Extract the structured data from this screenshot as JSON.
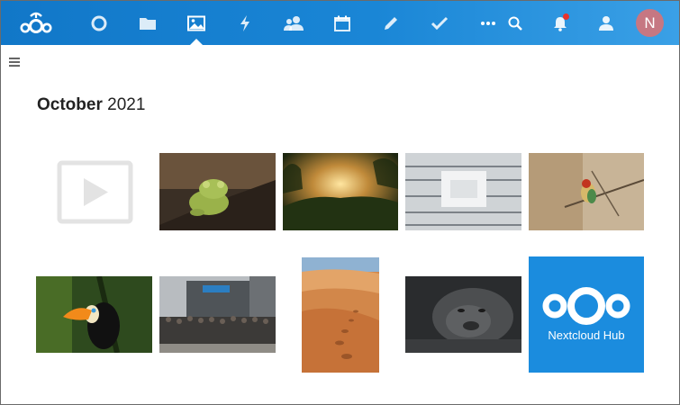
{
  "header": {
    "logo_icon": "nextcloud-logo-icon",
    "apps": [
      {
        "name": "dashboard",
        "icon": "circle-icon"
      },
      {
        "name": "files",
        "icon": "folder-icon"
      },
      {
        "name": "photos",
        "icon": "image-icon",
        "active": true
      },
      {
        "name": "activity",
        "icon": "lightning-icon"
      },
      {
        "name": "contacts",
        "icon": "contacts-icon"
      },
      {
        "name": "calendar",
        "icon": "calendar-icon"
      },
      {
        "name": "notes",
        "icon": "pencil-icon"
      },
      {
        "name": "tasks",
        "icon": "checkmark-icon"
      },
      {
        "name": "more",
        "icon": "ellipsis-icon"
      }
    ],
    "right_icons": [
      "search-icon",
      "bell-icon",
      "contacts-menu-icon"
    ],
    "avatar_initial": "N",
    "avatar_color": "#c67782",
    "accent": "#1a86d6"
  },
  "gallery": {
    "month": "October",
    "year": "2021",
    "items": [
      {
        "name": "video",
        "kind": "video-placeholder"
      },
      {
        "name": "frog",
        "kind": "photo"
      },
      {
        "name": "sunset-field",
        "kind": "photo"
      },
      {
        "name": "library",
        "kind": "photo"
      },
      {
        "name": "bird",
        "kind": "photo"
      },
      {
        "name": "toucan",
        "kind": "photo"
      },
      {
        "name": "group-photo",
        "kind": "photo"
      },
      {
        "name": "desert",
        "kind": "photo"
      },
      {
        "name": "gorilla",
        "kind": "photo"
      },
      {
        "name": "nextcloud-hub",
        "kind": "logo",
        "caption": "Nextcloud Hub"
      }
    ]
  }
}
